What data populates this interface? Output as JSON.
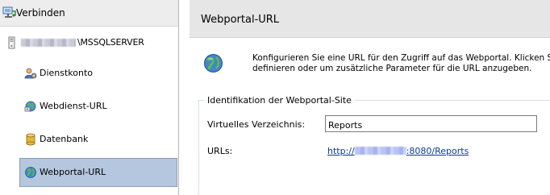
{
  "connect": {
    "label": "Verbinden"
  },
  "server": {
    "name_suffix": "\\MSSQLSERVER"
  },
  "nav": {
    "items": [
      {
        "label": "Dienstkonto",
        "icon": "service-account-icon"
      },
      {
        "label": "Webdienst-URL",
        "icon": "web-service-url-icon"
      },
      {
        "label": "Datenbank",
        "icon": "database-icon"
      },
      {
        "label": "Webportal-URL",
        "icon": "web-portal-globe-icon",
        "selected": true
      }
    ]
  },
  "page": {
    "title": "Webportal-URL",
    "description_line1": "Konfigurieren Sie eine URL für den Zugriff auf das Webportal. Klicken Sie",
    "description_line2": "definieren oder um zusätzliche Parameter für die URL anzugeben."
  },
  "identification": {
    "legend": "Identifikation der Webportal-Site",
    "virtual_directory_label": "Virtuelles Verzeichnis:",
    "virtual_directory_value": "Reports",
    "urls_label": "URLs:",
    "url_prefix": "http://",
    "url_suffix": ":8080/Reports"
  },
  "colors": {
    "selection_bg": "#b4c7df",
    "header_bg": "#e6e6e6",
    "link": "#0b3a9c"
  }
}
